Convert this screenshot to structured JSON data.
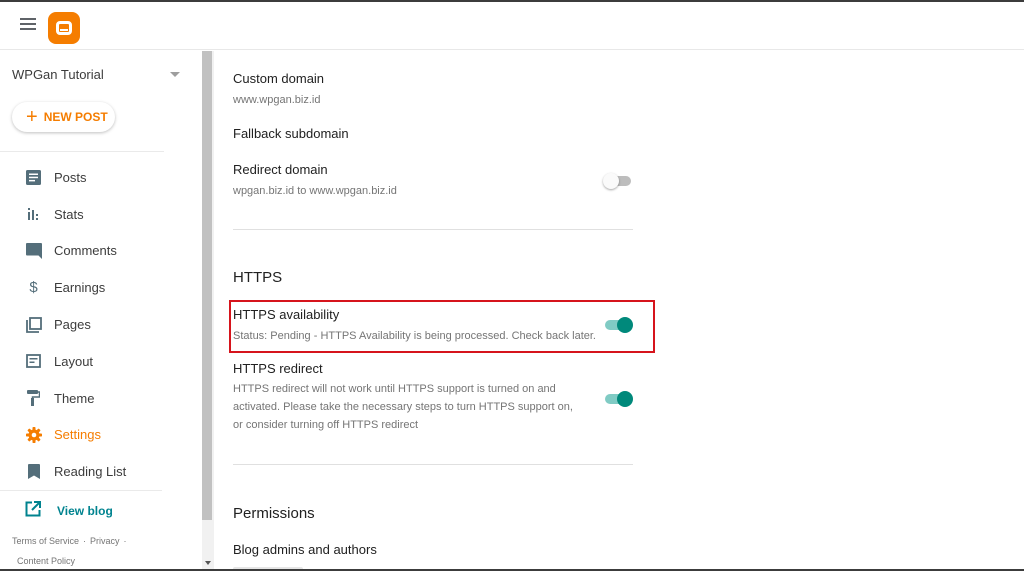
{
  "header": {
    "menu_icon": "hamburger-menu-icon",
    "logo": "blogger-logo"
  },
  "sidebar": {
    "blog_name": "WPGan Tutorial",
    "new_post_label": "NEW POST",
    "items": [
      {
        "label": "Posts",
        "icon": "posts-icon",
        "active": false
      },
      {
        "label": "Stats",
        "icon": "stats-icon",
        "active": false
      },
      {
        "label": "Comments",
        "icon": "comments-icon",
        "active": false
      },
      {
        "label": "Earnings",
        "icon": "dollar-icon",
        "active": false
      },
      {
        "label": "Pages",
        "icon": "pages-icon",
        "active": false
      },
      {
        "label": "Layout",
        "icon": "layout-icon",
        "active": false
      },
      {
        "label": "Theme",
        "icon": "paint-roller-icon",
        "active": false
      },
      {
        "label": "Settings",
        "icon": "gear-icon",
        "active": true
      },
      {
        "label": "Reading List",
        "icon": "bookmark-icon",
        "active": false
      }
    ],
    "view_blog_label": "View blog",
    "footer": {
      "terms": "Terms of Service",
      "privacy": "Privacy",
      "content_policy": "Content Policy",
      "separator": "·"
    }
  },
  "colors": {
    "accent": "#f57d00",
    "link": "#00838f",
    "toggle_on": "#00897b",
    "highlight_border": "#d6141c"
  },
  "main": {
    "custom_domain": {
      "label": "Custom domain",
      "value": "www.wpgan.biz.id"
    },
    "fallback_subdomain": {
      "label": "Fallback subdomain"
    },
    "redirect_domain": {
      "label": "Redirect domain",
      "value": "wpgan.biz.id to www.wpgan.biz.id",
      "enabled": false
    },
    "https_section": {
      "title": "HTTPS",
      "availability": {
        "label": "HTTPS availability",
        "status": "Status: Pending - HTTPS Availability is being processed. Check back later.",
        "enabled": true
      },
      "redirect": {
        "label": "HTTPS redirect",
        "description": "HTTPS redirect will not work until HTTPS support is turned on and activated. Please take the necessary steps to turn HTTPS support on, or consider turning off HTTPS redirect",
        "enabled": true
      }
    },
    "permissions_section": {
      "title": "Permissions",
      "admins_label": "Blog admins and authors"
    }
  }
}
